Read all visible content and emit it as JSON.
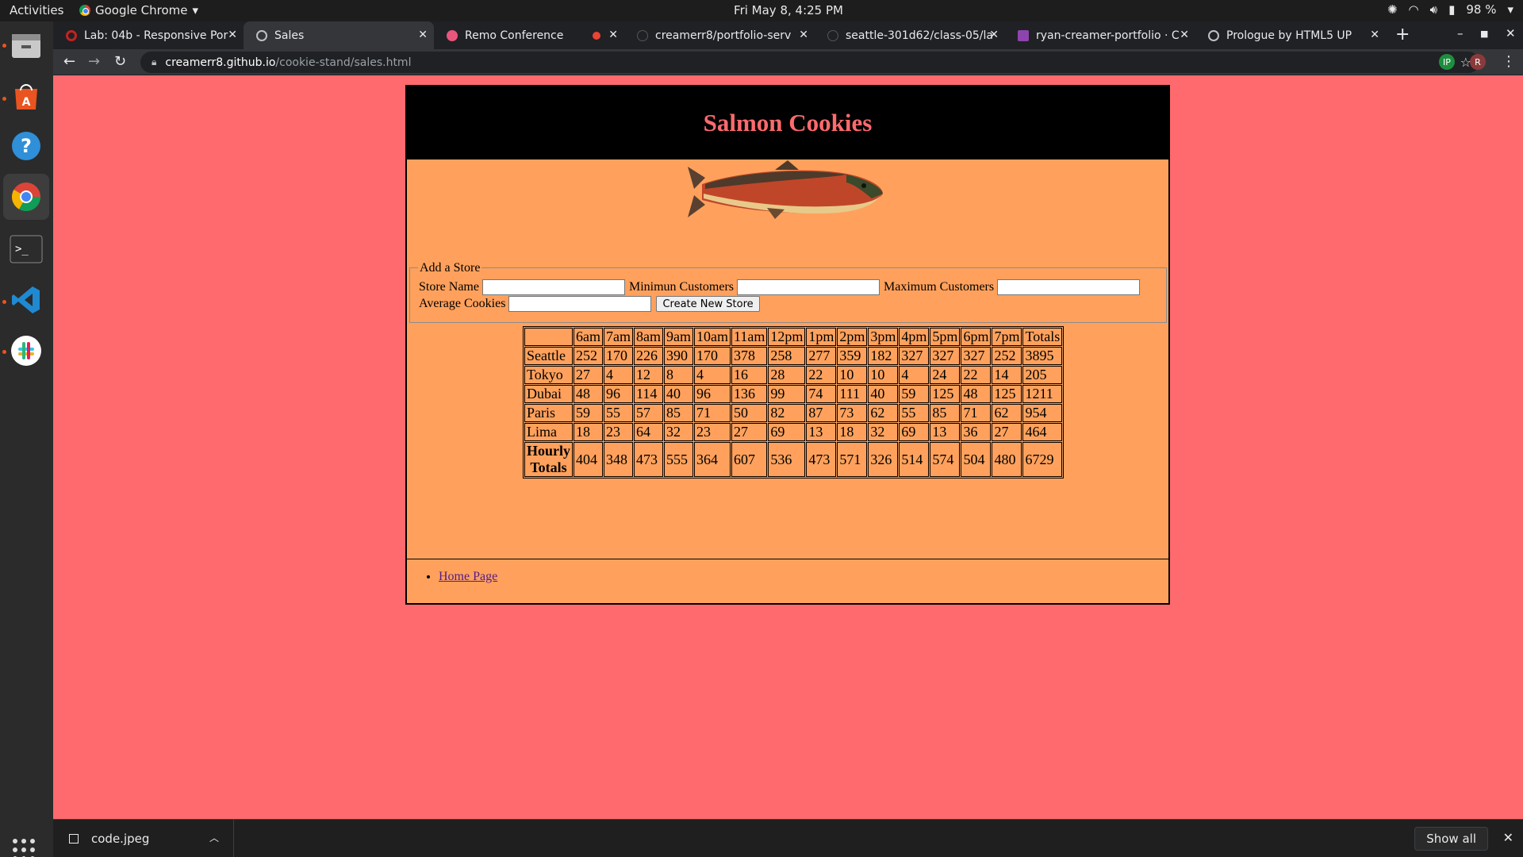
{
  "topbar": {
    "activities": "Activities",
    "app_name": "Google Chrome",
    "clock": "Fri May  8,  4:25 PM",
    "battery": "98 %"
  },
  "tabs": [
    {
      "title": "Lab: 04b - Responsive Por",
      "favicon_color": "#c5221f",
      "active": false
    },
    {
      "title": "Sales",
      "favicon_color": "#9aa0a6",
      "active": true
    },
    {
      "title": "Remo Conference",
      "favicon_color": "#e8567c",
      "active": false
    },
    {
      "title": "creamerr8/portfolio-serv",
      "favicon_color": "#202124",
      "active": false
    },
    {
      "title": "seattle-301d62/class-05/la",
      "favicon_color": "#202124",
      "active": false
    },
    {
      "title": "ryan-creamer-portfolio · C",
      "favicon_color": "#8e44ad",
      "active": false
    },
    {
      "title": "Prologue by HTML5 UP",
      "favicon_color": "#9aa0a6",
      "active": false
    }
  ],
  "address": {
    "host": "creamerr8.github.io",
    "path": "/cookie-stand/sales.html",
    "profile_initial": "R"
  },
  "page": {
    "heading": "Salmon Cookies",
    "form": {
      "legend": "Add a Store",
      "store_name_label": "Store Name",
      "min_label": "Minimun Customers",
      "max_label": "Maximum Customers",
      "avg_label": "Average Cookies",
      "submit_label": "Create New Store"
    },
    "table": {
      "headers": [
        "",
        "6am",
        "7am",
        "8am",
        "9am",
        "10am",
        "11am",
        "12pm",
        "1pm",
        "2pm",
        "3pm",
        "4pm",
        "5pm",
        "6pm",
        "7pm",
        "Totals"
      ],
      "rows": [
        {
          "store": "Seattle",
          "values": [
            "252",
            "170",
            "226",
            "390",
            "170",
            "378",
            "258",
            "277",
            "359",
            "182",
            "327",
            "327",
            "327",
            "252",
            "3895"
          ]
        },
        {
          "store": "Tokyo",
          "values": [
            "27",
            "4",
            "12",
            "8",
            "4",
            "16",
            "28",
            "22",
            "10",
            "10",
            "4",
            "24",
            "22",
            "14",
            "205"
          ]
        },
        {
          "store": "Dubai",
          "values": [
            "48",
            "96",
            "114",
            "40",
            "96",
            "136",
            "99",
            "74",
            "111",
            "40",
            "59",
            "125",
            "48",
            "125",
            "1211"
          ]
        },
        {
          "store": "Paris",
          "values": [
            "59",
            "55",
            "57",
            "85",
            "71",
            "50",
            "82",
            "87",
            "73",
            "62",
            "55",
            "85",
            "71",
            "62",
            "954"
          ]
        },
        {
          "store": "Lima",
          "values": [
            "18",
            "23",
            "64",
            "32",
            "23",
            "27",
            "69",
            "13",
            "18",
            "32",
            "69",
            "13",
            "36",
            "27",
            "464"
          ]
        }
      ],
      "footer_label_line1": "Hourly",
      "footer_label_line2": "Totals",
      "footer_values": [
        "404",
        "348",
        "473",
        "555",
        "364",
        "607",
        "536",
        "473",
        "571",
        "326",
        "514",
        "574",
        "504",
        "480",
        "6729"
      ]
    },
    "footer_link": "Home Page"
  },
  "downloads": {
    "file_name": "code.jpeg",
    "show_all": "Show all"
  }
}
